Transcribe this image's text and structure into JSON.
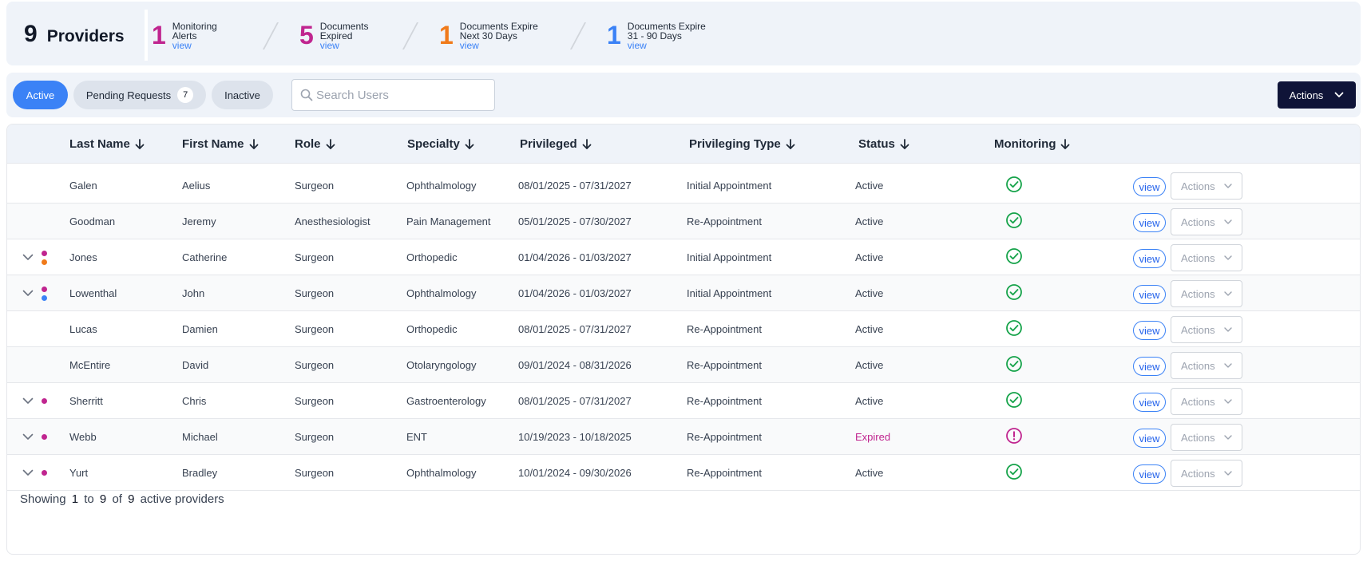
{
  "summary": {
    "providers_count": "9",
    "providers_label": "Providers",
    "stats": [
      {
        "num": "1",
        "line1": "Monitoring",
        "line2": "Alerts",
        "view": "view",
        "color": "#c0258f"
      },
      {
        "num": "5",
        "line1": "Documents",
        "line2": "Expired",
        "view": "view",
        "color": "#c0258f"
      },
      {
        "num": "1",
        "line1": "Documents Expire",
        "line2": "Next 30 Days",
        "view": "view",
        "color": "#f07a1a"
      },
      {
        "num": "1",
        "line1": "Documents Expire",
        "line2": "31 - 90 Days",
        "view": "view",
        "color": "#3b82f6"
      }
    ]
  },
  "toolbar": {
    "tabs": [
      {
        "label": "Active",
        "active": true
      },
      {
        "label": "Pending Requests",
        "badge": "7"
      },
      {
        "label": "Inactive"
      }
    ],
    "search_placeholder": "Search Users",
    "actions_label": "Actions"
  },
  "table": {
    "headers": [
      "Last Name",
      "First Name",
      "Role",
      "Specialty",
      "Privileged",
      "Privileging Type",
      "Status",
      "Monitoring"
    ],
    "rows": [
      {
        "last": "Galen",
        "first": "Aelius",
        "role": "Surgeon",
        "specialty": "Ophthalmology",
        "privileged": "08/01/2025 - 07/31/2027",
        "type": "Initial Appointment",
        "status": "Active",
        "monitoring": "ok",
        "expand": false,
        "dots": []
      },
      {
        "last": "Goodman",
        "first": "Jeremy",
        "role": "Anesthesiologist",
        "specialty": "Pain Management",
        "privileged": "05/01/2025 - 07/30/2027",
        "type": "Re-Appointment",
        "status": "Active",
        "monitoring": "ok",
        "expand": false,
        "dots": []
      },
      {
        "last": "Jones",
        "first": "Catherine",
        "role": "Surgeon",
        "specialty": "Orthopedic",
        "privileged": "01/04/2026 - 01/03/2027",
        "type": "Initial Appointment",
        "status": "Active",
        "monitoring": "ok",
        "expand": true,
        "dots": [
          "#c0258f",
          "#f07a1a"
        ]
      },
      {
        "last": "Lowenthal",
        "first": "John",
        "role": "Surgeon",
        "specialty": "Ophthalmology",
        "privileged": "01/04/2026 - 01/03/2027",
        "type": "Initial Appointment",
        "status": "Active",
        "monitoring": "ok",
        "expand": true,
        "dots": [
          "#c0258f",
          "#3b82f6"
        ]
      },
      {
        "last": "Lucas",
        "first": "Damien",
        "role": "Surgeon",
        "specialty": "Orthopedic",
        "privileged": "08/01/2025 - 07/31/2027",
        "type": "Re-Appointment",
        "status": "Active",
        "monitoring": "ok",
        "expand": false,
        "dots": []
      },
      {
        "last": "McEntire",
        "first": "David",
        "role": "Surgeon",
        "specialty": "Otolaryngology",
        "privileged": "09/01/2024 - 08/31/2026",
        "type": "Re-Appointment",
        "status": "Active",
        "monitoring": "ok",
        "expand": false,
        "dots": []
      },
      {
        "last": "Sherritt",
        "first": "Chris",
        "role": "Surgeon",
        "specialty": "Gastroenterology",
        "privileged": "08/01/2025 - 07/31/2027",
        "type": "Re-Appointment",
        "status": "Active",
        "monitoring": "ok",
        "expand": true,
        "dots": [
          "#c0258f"
        ]
      },
      {
        "last": "Webb",
        "first": "Michael",
        "role": "Surgeon",
        "specialty": "ENT",
        "privileged": "10/19/2023 - 10/18/2025",
        "type": "Re-Appointment",
        "status": "Expired",
        "monitoring": "alert",
        "expand": true,
        "dots": [
          "#c0258f"
        ]
      },
      {
        "last": "Yurt",
        "first": "Bradley",
        "role": "Surgeon",
        "specialty": "Ophthalmology",
        "privileged": "10/01/2024 - 09/30/2026",
        "type": "Re-Appointment",
        "status": "Active",
        "monitoring": "ok",
        "expand": true,
        "dots": [
          "#c0258f"
        ]
      }
    ],
    "view_label": "view",
    "row_actions_label": "Actions"
  },
  "footer": {
    "prefix": "Showing",
    "from": "1",
    "to_word": "to",
    "to": "9",
    "of_word": "of",
    "total": "9",
    "suffix": "active providers"
  },
  "colors": {
    "accent": "#3b82f6",
    "ok": "#16a34a",
    "alert": "#c0258f",
    "dark": "#0f1438"
  }
}
